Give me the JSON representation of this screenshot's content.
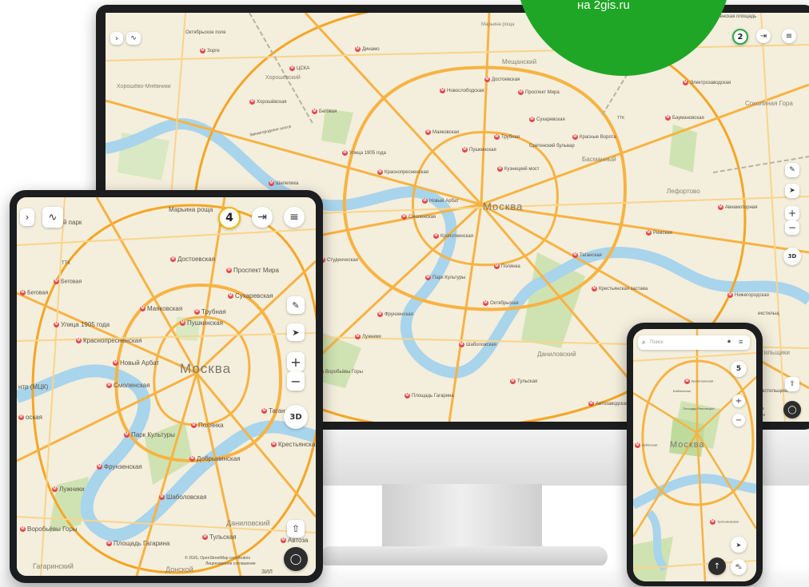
{
  "promo": {
    "text": "на 2gis.ru",
    "color": "#1fa626"
  },
  "monitor": {
    "counter": "2",
    "labels": {
      "city": "Москва",
      "oktyabrskoe_pole": "Октябрьское поле",
      "zorge": "Зорге",
      "cska": "ЦСКА",
      "khoroshevskiy": "Хорошёвский",
      "khoroshevo": "Хорошёво-Мнёвники",
      "khoroshevskaya": "Хорошёвская",
      "dinamo": "Динамо",
      "maryina_roshcha": "Марьина роща",
      "meshchanskiy": "Мещанский",
      "dostoevskaya": "Достоевская",
      "novoslobodskaya": "Новослободская",
      "prospekt_mira": "Проспект Мира",
      "preobr": "Преображенская площадь",
      "elektrozavodskaya": "Электрозаводская",
      "sokolinaya": "Соколиная Гора",
      "baumanskaya": "Баумановская",
      "sukharevskaya": "Сухаревская",
      "krasnye_vorota": "Красные Ворота",
      "sretenskiy": "Сретенский бульвар",
      "trubnaya": "Трубная",
      "mayakovskaya": "Маяковская",
      "pushkinskaya": "Пушкинская",
      "ulitsa1905": "Улица 1905 года",
      "krasnopresnenskaya": "Краснопресненская",
      "kuznetskiy": "Кузнецкий мост",
      "basmanny": "Басманный",
      "begovaya": "Беговая",
      "shelepikha": "Шелепиха",
      "novy_arbat": "Новый Арбат",
      "smolenskaya": "Смоленская",
      "kropotkinskaya": "Кропоткинская",
      "studencheskaya": "Студенческая",
      "park_kultury": "Парк Культуры",
      "polyanka": "Полянка",
      "oktyabrskaya": "Октябрьская",
      "frunzenskaya": "Фрунзенская",
      "taganskaya": "Таганская",
      "lefortovo": "Лефортово",
      "rimskaya": "Римская",
      "aviamotornaya": "Авиамоторная",
      "nizhegorodskaya": "Нижегородская",
      "krestyanskaya": "Крестьянская застава",
      "luzhniki": "Лужники",
      "shabolovskaya": "Шаболовская",
      "danilovskiy": "Даниловский",
      "tulskaya": "Тульская",
      "vorobyovy": "Воробьёвы Горы",
      "gagarina": "Площадь Гагарина",
      "avtozavodskaya": "Автозаводская",
      "tekstilshchiki": "Текстильщики",
      "ttk": "ТТК",
      "zvenig": "Звенигородское шоссе"
    }
  },
  "tablet": {
    "counter": "4",
    "btn_3d": "3D",
    "attribution": "© 2GIS, OpenStreetMap contributors",
    "license": "Лицензионное соглашение",
    "labels": {
      "city": "Москва",
      "maryina_roshcha": "Марьина роща",
      "park": "ский парк",
      "dostoevskaya": "Достоевская",
      "prospekt_mira": "Проспект Мира",
      "begovaya1": "Беговая",
      "begovaya2": "Беговая",
      "sukharevskaya": "Сухаревская",
      "mayakovskaya": "Маяковская",
      "trubnaya": "Трубная",
      "pushkinskaya": "Пушкинская",
      "ulitsa1905": "Улица 1905 года",
      "krasnopresnenskaya": "Краснопресненская",
      "novy_arbat": "Новый Арбат",
      "smolenskaya": "Смоленская",
      "mck": "нтр (МЦК)",
      "oskaya": "оская",
      "taganskaya": "Таганск",
      "park_kultury": "Парк Культуры",
      "polyanka": "Полянка",
      "krestyanskaya": "Крестьянская",
      "frunzenskaya": "Фрунзенская",
      "dobryninskaya": "Добрынинская",
      "luzhniki": "Лужники",
      "shabolovskaya": "Шаболовская",
      "danilovskiy": "Даниловский",
      "tulskaya": "Тульская",
      "avtozav": "Автоза",
      "vorobyovy": "Воробьёвы Горы",
      "gagarina": "Площадь Гагарина",
      "gagarinskiy": "Гагаринский",
      "donskoy": "Донской",
      "zil": "ЗИЛ",
      "ttk": "ТТК"
    }
  },
  "phone": {
    "search_placeholder": "Поиск",
    "counter": "5",
    "labels": {
      "city": "Москва",
      "kropotkinskaya": "Кропоткинская",
      "ploshchad_rev": "Площадь Революции",
      "biblioteka": "Библиотека",
      "arbatskaya": "Арбатская",
      "tretyakovskaya": "Третьяковская"
    }
  },
  "monitor_extra": {
    "tekstilshchiki_short": "стильщики",
    "tekstilshchiki_link": "екстильщ",
    "attribution_short": "butors",
    "license_short": "шение"
  }
}
